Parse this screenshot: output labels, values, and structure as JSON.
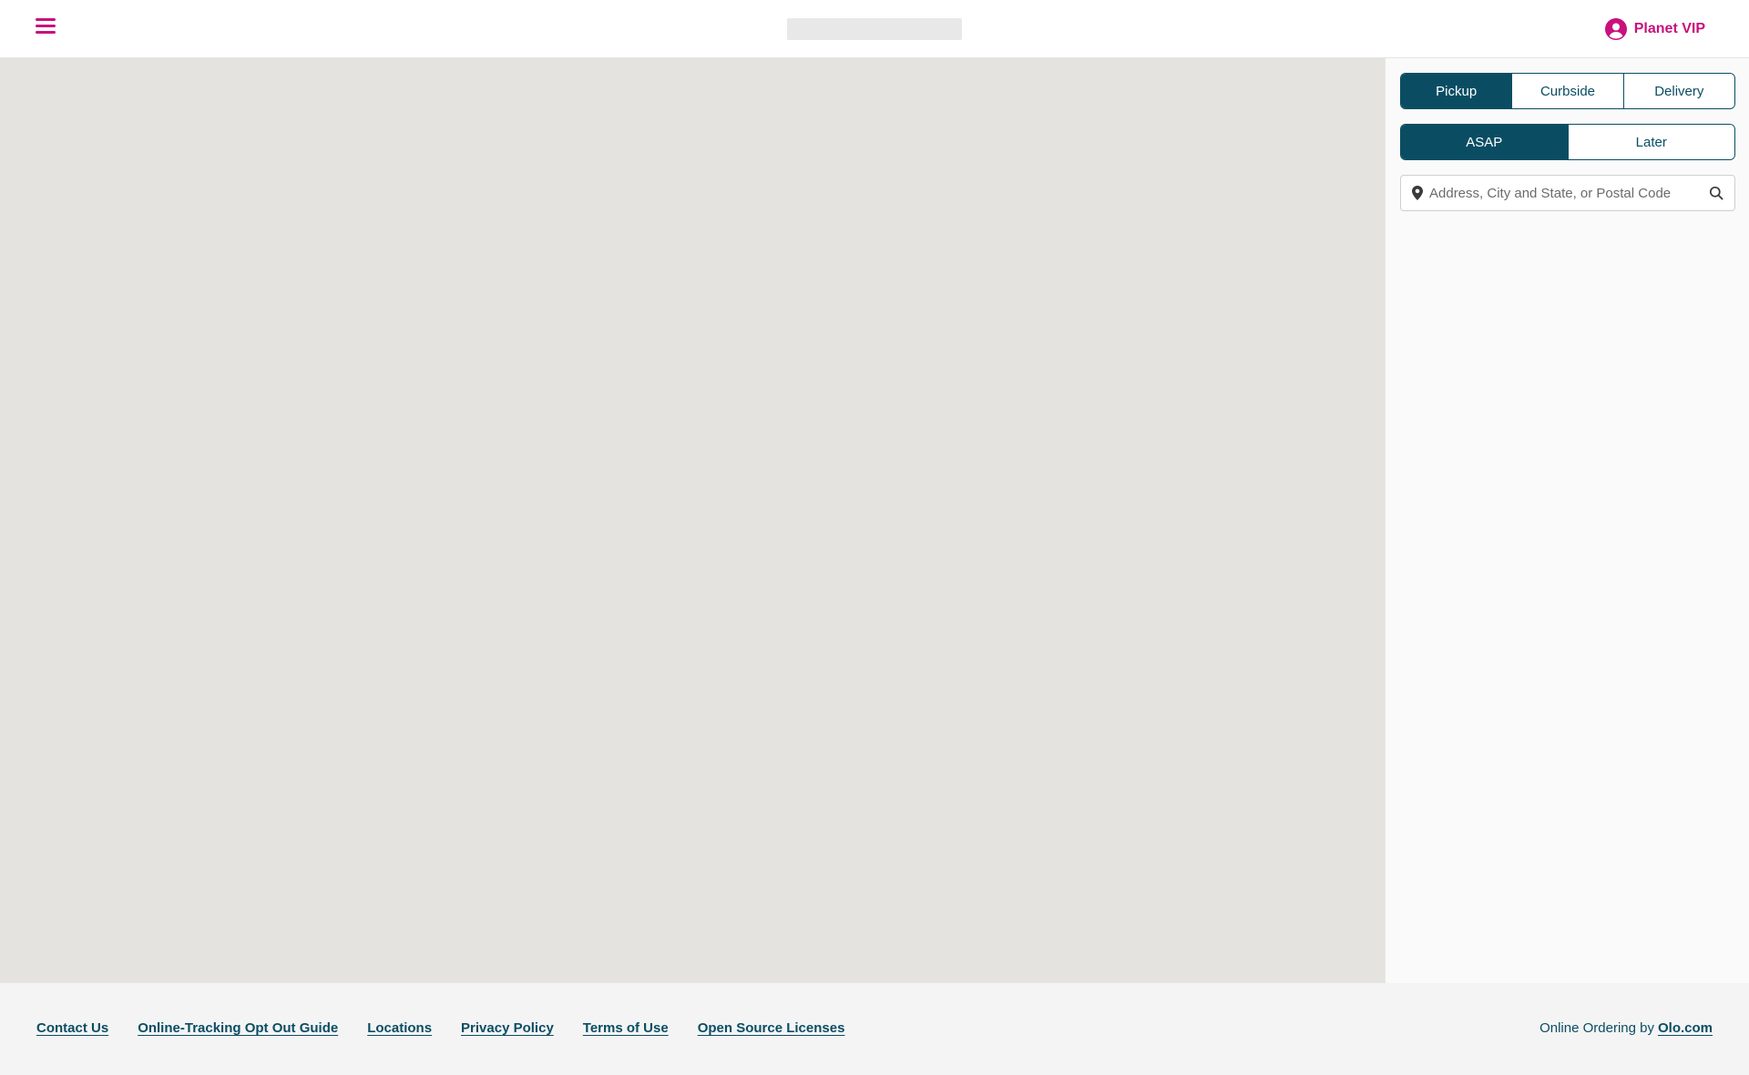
{
  "colors": {
    "brand_pink": "#c8117d",
    "primary_teal": "#0a4d63",
    "map_background": "#e5e3df",
    "panel_background": "#fafafa",
    "footer_background": "#f4f4f4"
  },
  "header": {
    "menu_icon": "hamburger-icon",
    "account_icon": "user-circle-icon",
    "account_label": "Planet VIP"
  },
  "order_panel": {
    "mode_tabs": [
      {
        "label": "Pickup",
        "selected": true
      },
      {
        "label": "Curbside",
        "selected": false
      },
      {
        "label": "Delivery",
        "selected": false
      }
    ],
    "time_tabs": [
      {
        "label": "ASAP",
        "selected": true
      },
      {
        "label": "Later",
        "selected": false
      }
    ],
    "search": {
      "value": "",
      "placeholder": "Address, City and State, or Postal Code",
      "leading_icon": "map-pin-icon",
      "trailing_icon": "search-icon"
    }
  },
  "map": {
    "accessibility_button_icon": "accessibility-toggle-icon"
  },
  "footer": {
    "links": [
      "Contact Us",
      "Online-Tracking Opt Out Guide",
      "Locations",
      "Privacy Policy",
      "Terms of Use",
      "Open Source Licenses"
    ],
    "credit_prefix": "Online Ordering by",
    "credit_link": "Olo.com"
  }
}
